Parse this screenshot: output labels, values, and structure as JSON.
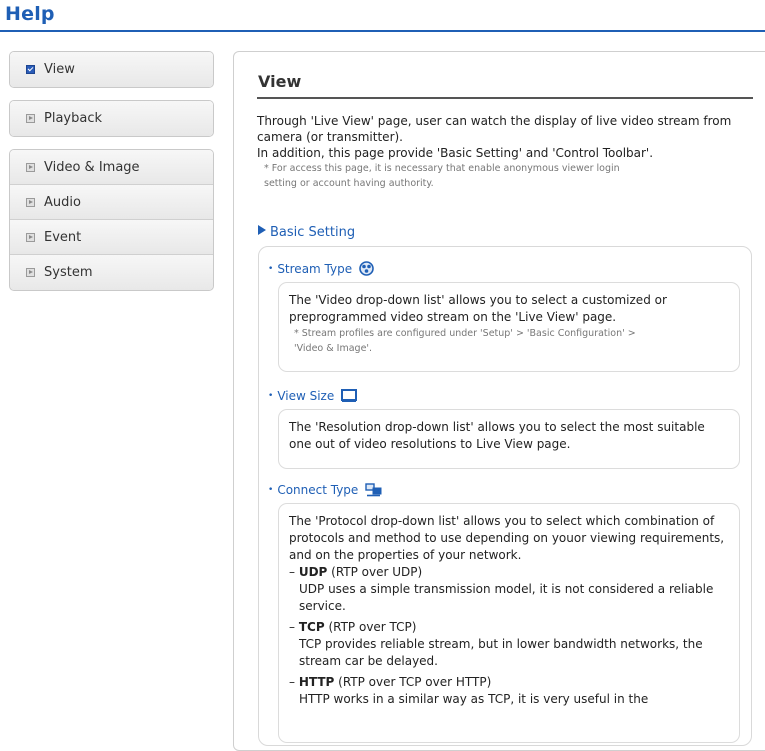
{
  "header": {
    "title": "Help"
  },
  "sidebar": {
    "groups": [
      {
        "items": [
          {
            "label": "View",
            "active": true
          }
        ]
      },
      {
        "items": [
          {
            "label": "Playback",
            "active": false
          }
        ]
      },
      {
        "items": [
          {
            "label": "Video & Image",
            "active": false
          },
          {
            "label": "Audio",
            "active": false
          },
          {
            "label": "Event",
            "active": false
          },
          {
            "label": "System",
            "active": false
          }
        ]
      }
    ]
  },
  "main": {
    "title": "View",
    "intro_lines": [
      "Through 'Live View' page, user can watch the display of live video stream from camera (or transmitter).",
      "In addition, this page provide 'Basic Setting' and 'Control Toolbar'."
    ],
    "intro_note": [
      "* For access this page, it is necessary that enable anonymous viewer login",
      "setting or account having authority."
    ],
    "section_heading": "Basic Setting",
    "stream_type": {
      "heading": "Stream Type",
      "icon": "stream-type-icon",
      "description": "The 'Video drop-down list' allows you to select a customized or preprogrammed video stream on the 'Live View' page.",
      "note": [
        "* Stream profiles are configured under 'Setup' > 'Basic Configuration' >",
        "'Video & Image'."
      ]
    },
    "view_size": {
      "heading": "View Size",
      "icon": "monitor-icon",
      "description": "The 'Resolution drop-down list' allows you to select the most suitable one out of video resolutions to Live View page."
    },
    "connect_type": {
      "heading": "Connect Type",
      "icon": "network-icon",
      "description": "The 'Protocol drop-down list' allows you to select which combination of protocols and method to use depending on youor viewing requirements, and on the properties of your network.",
      "protocols": [
        {
          "dash": "–",
          "name": "UDP",
          "detail": "(RTP over UDP)",
          "text": "UDP uses a simple transmission model, it is not considered a reliable service."
        },
        {
          "dash": "–",
          "name": "TCP",
          "detail": "(RTP over TCP)",
          "text": "TCP provides reliable stream, but in lower bandwidth networks, the stream car be delayed."
        },
        {
          "dash": "–",
          "name": "HTTP",
          "detail": "(RTP over TCP over HTTP)",
          "text": "HTTP works in a similar way as TCP, it is very useful in the"
        }
      ]
    }
  },
  "colors": {
    "accent": "#1f5fb5",
    "rule": "#555555",
    "note": "#777777"
  }
}
